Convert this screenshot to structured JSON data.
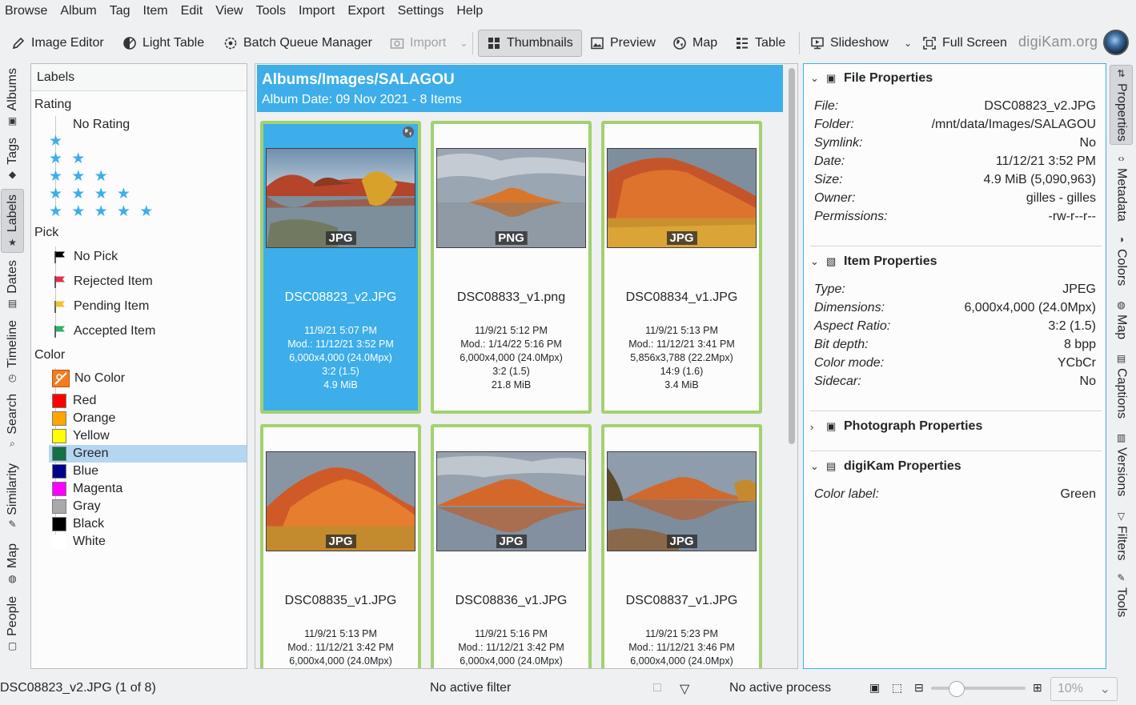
{
  "menubar": [
    "Browse",
    "Album",
    "Tag",
    "Item",
    "Edit",
    "View",
    "Tools",
    "Import",
    "Export",
    "Settings",
    "Help"
  ],
  "toolbar": {
    "image_editor": "Image Editor",
    "light_table": "Light Table",
    "batch_queue": "Batch Queue Manager",
    "import": "Import",
    "thumbnails": "Thumbnails",
    "preview": "Preview",
    "map": "Map",
    "table": "Table",
    "slideshow": "Slideshow",
    "full_screen": "Full Screen",
    "brand": "digiKam.org"
  },
  "left_tabs": [
    "Albums",
    "Tags",
    "Labels",
    "Dates",
    "Timeline",
    "Search",
    "Similarity",
    "Map",
    "People"
  ],
  "labels_panel": {
    "title": "Labels",
    "rating_title": "Rating",
    "no_rating": "No Rating",
    "stars": [
      "★",
      "★ ★",
      "★ ★ ★",
      "★ ★ ★ ★",
      "★ ★ ★ ★ ★"
    ],
    "pick_title": "Pick",
    "picks": [
      {
        "label": "No Pick",
        "color": "#000000"
      },
      {
        "label": "Rejected Item",
        "color": "#e0304a"
      },
      {
        "label": "Pending Item",
        "color": "#f2c12e"
      },
      {
        "label": "Accepted Item",
        "color": "#2fb36b"
      }
    ],
    "color_title": "Color",
    "colors": [
      {
        "label": "No Color",
        "color": "#f57b20"
      },
      {
        "label": "Red",
        "color": "#ff0000"
      },
      {
        "label": "Orange",
        "color": "#ffa500"
      },
      {
        "label": "Yellow",
        "color": "#ffff00"
      },
      {
        "label": "Green",
        "color": "#136f44"
      },
      {
        "label": "Blue",
        "color": "#00008b"
      },
      {
        "label": "Magenta",
        "color": "#ff00ff"
      },
      {
        "label": "Gray",
        "color": "#a9a9a9"
      },
      {
        "label": "Black",
        "color": "#000000"
      },
      {
        "label": "White",
        "color": "#ffffff"
      }
    ]
  },
  "album": {
    "title": "Albums/Images/SALAGOU",
    "subtitle": "Album Date: 09 Nov 2021 - 8 Items"
  },
  "thumbnails": [
    {
      "name": "DSC08823_v2.JPG",
      "format": "JPG",
      "date": "11/9/21 5:07 PM",
      "mod": "Mod.: 11/12/21 3:52 PM",
      "dims": "6,000x4,000 (24.0Mpx)",
      "ratio": "3:2 (1.5)",
      "size": "4.9 MiB"
    },
    {
      "name": "DSC08833_v1.png",
      "format": "PNG",
      "date": "11/9/21 5:12 PM",
      "mod": "Mod.: 1/14/22 5:16 PM",
      "dims": "6,000x4,000 (24.0Mpx)",
      "ratio": "3:2 (1.5)",
      "size": "21.8 MiB"
    },
    {
      "name": "DSC08834_v1.JPG",
      "format": "JPG",
      "date": "11/9/21 5:13 PM",
      "mod": "Mod.: 11/12/21 3:41 PM",
      "dims": "5,856x3,788 (22.2Mpx)",
      "ratio": "14:9 (1.6)",
      "size": "3.4 MiB"
    },
    {
      "name": "DSC08835_v1.JPG",
      "format": "JPG",
      "date": "11/9/21 5:13 PM",
      "mod": "Mod.: 11/12/21 3:42 PM",
      "dims": "6,000x4,000 (24.0Mpx)"
    },
    {
      "name": "DSC08836_v1.JPG",
      "format": "JPG",
      "date": "11/9/21 5:16 PM",
      "mod": "Mod.: 11/12/21 3:42 PM",
      "dims": "6,000x4,000 (24.0Mpx)"
    },
    {
      "name": "DSC08837_v1.JPG",
      "format": "JPG",
      "date": "11/9/21 5:23 PM",
      "mod": "Mod.: 11/12/21 3:46 PM",
      "dims": "6,000x4,000 (24.0Mpx)"
    }
  ],
  "properties": {
    "file_title": "File Properties",
    "file": [
      [
        "File:",
        "DSC08823_v2.JPG"
      ],
      [
        "Folder:",
        "/mnt/data/Images/SALAGOU"
      ],
      [
        "Symlink:",
        "No"
      ],
      [
        "Date:",
        "11/12/21 3:52 PM"
      ],
      [
        "Size:",
        "4.9 MiB (5,090,963)"
      ],
      [
        "Owner:",
        "gilles - gilles"
      ],
      [
        "Permissions:",
        "-rw-r--r--"
      ]
    ],
    "item_title": "Item Properties",
    "item": [
      [
        "Type:",
        "JPEG"
      ],
      [
        "Dimensions:",
        "6,000x4,000 (24.0Mpx)"
      ],
      [
        "Aspect Ratio:",
        "3:2 (1.5)"
      ],
      [
        "Bit depth:",
        "8 bpp"
      ],
      [
        "Color mode:",
        "YCbCr"
      ],
      [
        "Sidecar:",
        "No"
      ]
    ],
    "photo_title": "Photograph Properties",
    "digikam_title": "digiKam Properties",
    "digikam": [
      [
        "Color label:",
        "Green"
      ]
    ]
  },
  "right_tabs": [
    "Properties",
    "Metadata",
    "Colors",
    "Map",
    "Captions",
    "Versions",
    "Filters",
    "Tools"
  ],
  "status": {
    "current": "DSC08823_v2.JPG (1 of 8)",
    "filter": "No active filter",
    "process": "No active process",
    "zoom": "10%",
    "zoom_level": 0.22
  }
}
